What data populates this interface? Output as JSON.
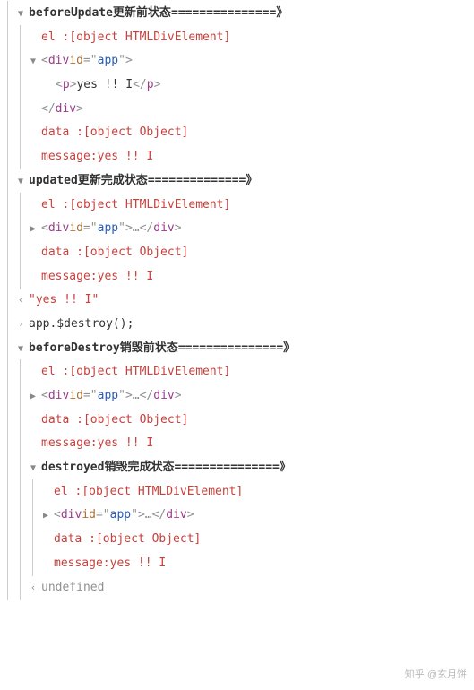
{
  "logs": {
    "beforeUpdate": {
      "title_prefix": "beforeUpdate ",
      "title_cn": "更新前状态",
      "title_suffix": "===============》",
      "el_label": "el     : ",
      "el_value": "[object HTMLDivElement]",
      "div_open_1": "<",
      "div_open_tag": "div",
      "div_id_attr": " id",
      "div_id_eq": "=",
      "div_id_q1": "\"",
      "div_id_val": "app",
      "div_id_q2": "\"",
      "div_open_close": ">",
      "p_open_1": "<",
      "p_open_tag": "p",
      "p_open_close": ">",
      "p_text": "yes !! I",
      "p_close_1": "</",
      "p_close_tag": "p",
      "p_close_close": ">",
      "div_close_1": "</",
      "div_close_tag": "div",
      "div_close_close": ">",
      "data_label": "data   : ",
      "data_value": "[object Object]",
      "msg_label": "message: ",
      "msg_value": "yes !! I"
    },
    "updated": {
      "title_prefix": "updated ",
      "title_cn": "更新完成状态",
      "title_suffix": "==============》",
      "el_label": "el     : ",
      "el_value": "[object HTMLDivElement]",
      "div_open_1": "<",
      "div_open_tag": "div",
      "div_id_attr": " id",
      "div_id_eq": "=",
      "div_id_q1": "\"",
      "div_id_val": "app",
      "div_id_q2": "\"",
      "div_open_close": ">",
      "div_ellipsis": "…",
      "div_close_1": "</",
      "div_close_tag": "div",
      "div_close_close": ">",
      "data_label": "data   : ",
      "data_value": "[object Object]",
      "msg_label": "message: ",
      "msg_value": "yes !! I"
    },
    "return_line": "\"yes !! I\"",
    "input_line": "app.$destroy();",
    "beforeDestroy": {
      "title_prefix": "beforeDestroy ",
      "title_cn": "销毁前状态",
      "title_suffix": "===============》",
      "el_label": "el     : ",
      "el_value": "[object HTMLDivElement]",
      "div_open_1": "<",
      "div_open_tag": "div",
      "div_id_attr": " id",
      "div_id_eq": "=",
      "div_id_q1": "\"",
      "div_id_val": "app",
      "div_id_q2": "\"",
      "div_open_close": ">",
      "div_ellipsis": "…",
      "div_close_1": "</",
      "div_close_tag": "div",
      "div_close_close": ">",
      "data_label": "data   : ",
      "data_value": "[object Object]",
      "msg_label": "message: ",
      "msg_value": "yes !! I"
    },
    "destroyed": {
      "title_prefix": "destroyed ",
      "title_cn": "销毁完成状态",
      "title_suffix": "===============》",
      "el_label": "el     : ",
      "el_value": "[object HTMLDivElement]",
      "div_open_1": "<",
      "div_open_tag": "div",
      "div_id_attr": " id",
      "div_id_eq": "=",
      "div_id_q1": "\"",
      "div_id_val": "app",
      "div_id_q2": "\"",
      "div_open_close": ">",
      "div_ellipsis": "…",
      "div_close_1": "</",
      "div_close_tag": "div",
      "div_close_close": ">",
      "data_label": "data   : ",
      "data_value": "[object Object]",
      "msg_label": "message: ",
      "msg_value": "yes !! I"
    },
    "undefined_line": "undefined"
  },
  "toggles": {
    "down": "▼",
    "right": "▶",
    "in": "›",
    "out": "‹"
  },
  "watermark": "知乎 @玄月饼"
}
